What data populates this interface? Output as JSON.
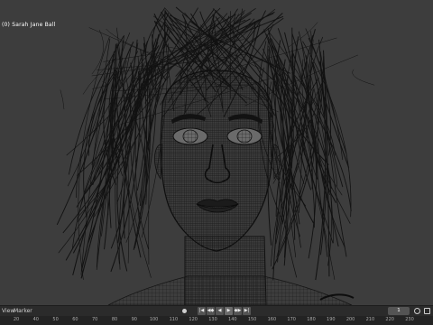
{
  "viewport": {
    "object_label": "(0) Sarah Jane Ball"
  },
  "timeline": {
    "menu": {
      "view": "View",
      "marker": "Marker"
    },
    "transport_icons": [
      "jump-start-icon",
      "prev-keyframe-icon",
      "play-reverse-icon",
      "play-icon",
      "next-keyframe-icon",
      "jump-end-icon"
    ],
    "transport_glyphs": [
      "|◀",
      "◀◆",
      "◀",
      "▶",
      "◆▶",
      "▶|"
    ],
    "current_frame": "1",
    "ruler_ticks": [
      "20",
      "40",
      "50",
      "60",
      "70",
      "80",
      "90",
      "100",
      "110",
      "120",
      "130",
      "140",
      "150",
      "160",
      "170",
      "180",
      "190",
      "200",
      "210",
      "220",
      "230"
    ]
  },
  "colors": {
    "viewport_bg": "#3d3d3d",
    "wire": "#111111",
    "header_bg": "#2b2b2b"
  }
}
